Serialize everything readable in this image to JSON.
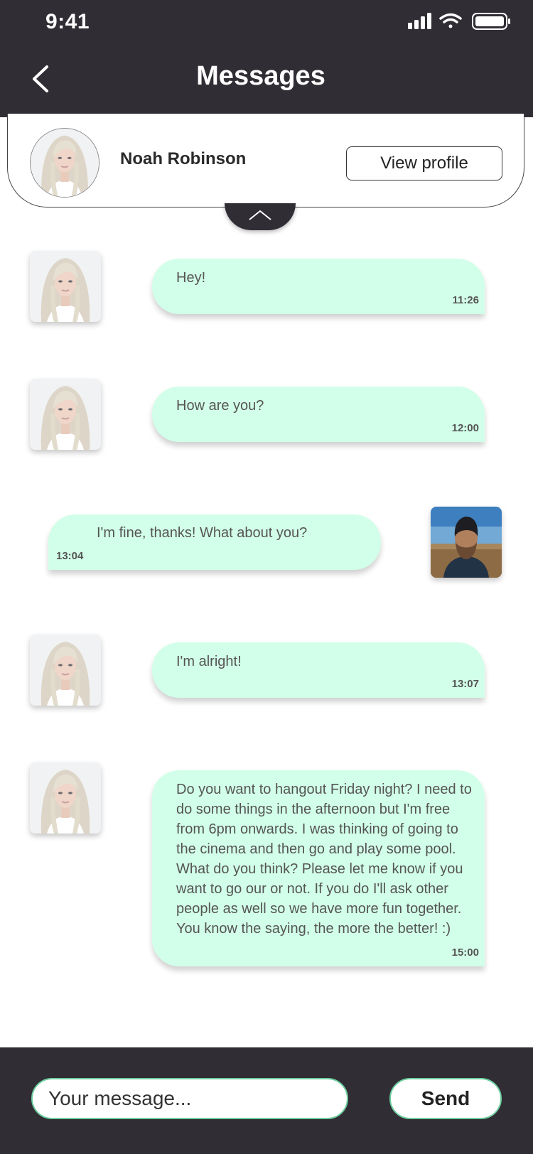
{
  "status_bar": {
    "time": "9:41"
  },
  "header": {
    "title": "Messages"
  },
  "contact": {
    "name": "Noah Robinson",
    "view_profile_label": "View profile"
  },
  "messages": [
    {
      "direction": "incoming",
      "text": "Hey!",
      "time": "11:26"
    },
    {
      "direction": "incoming",
      "text": "How are you?",
      "time": "12:00"
    },
    {
      "direction": "outgoing",
      "text": "I'm fine, thanks! What about you?",
      "time": "13:04"
    },
    {
      "direction": "incoming",
      "text": "I'm alright!",
      "time": "13:07"
    },
    {
      "direction": "incoming",
      "text": "Do you want to hangout Friday night? I need to do some things in the afternoon but I'm free from 6pm onwards. I was thinking of going to the cinema and then go and play some pool. What do you think? Please let me know if you want to go our or not. If you do I'll ask other people as well so we have more fun together. You know the saying, the more the better! :)",
      "time": "15:00"
    }
  ],
  "composer": {
    "placeholder": "Your message...",
    "send_label": "Send"
  },
  "colors": {
    "bar_bg": "#312d35",
    "bubble_bg": "#d2ffe9",
    "accent_border": "#6ccf9e"
  }
}
